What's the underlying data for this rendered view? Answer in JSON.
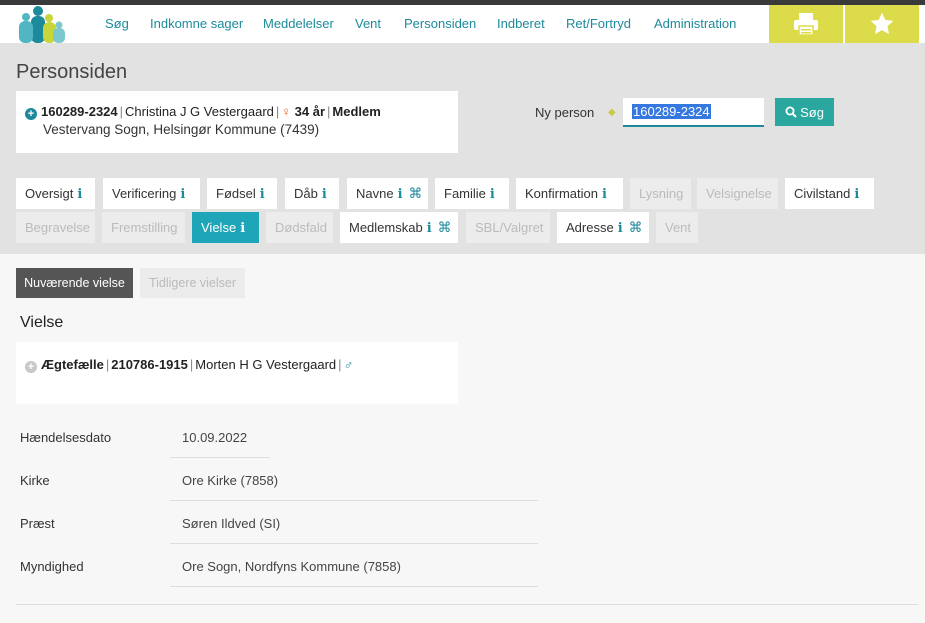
{
  "nav": {
    "items": [
      {
        "label": "Søg"
      },
      {
        "label": "Indkomne sager"
      },
      {
        "label": "Meddelelser"
      },
      {
        "label": "Vent"
      },
      {
        "label": "Personsiden"
      },
      {
        "label": "Indberet"
      },
      {
        "label": "Ret/Fortryd"
      },
      {
        "label": "Administration"
      }
    ],
    "print_icon": "printer-icon",
    "star_icon": "star-icon"
  },
  "page_title": "Personsiden",
  "person": {
    "cpr": "160289-2324",
    "name": "Christina J G Vestergaard",
    "age": "34 år",
    "status": "Medlem",
    "address": "Vestervang Sogn, Helsingør Kommune (7439)"
  },
  "new_person": {
    "label": "Ny person",
    "value": "160289-2324",
    "search_label": "Søg"
  },
  "tabs": {
    "row1": [
      {
        "label": "Oversigt",
        "info": "i"
      },
      {
        "label": "Verificering",
        "info": "i"
      },
      {
        "label": "Fødsel",
        "info": "i"
      },
      {
        "label": "Dåb",
        "info": "i"
      },
      {
        "label": "Navne",
        "info": "i",
        "cmd": "⌘"
      },
      {
        "label": "Familie",
        "info": "i"
      },
      {
        "label": "Konfirmation",
        "info": "i"
      },
      {
        "label": "Lysning"
      },
      {
        "label": "Velsignelse"
      },
      {
        "label": "Civilstand",
        "info": "i"
      }
    ],
    "row2": [
      {
        "label": "Begravelse"
      },
      {
        "label": "Fremstilling"
      },
      {
        "label": "Vielse",
        "info": "i"
      },
      {
        "label": "Dødsfald"
      },
      {
        "label": "Medlemskab",
        "info": "i",
        "cmd": "⌘"
      },
      {
        "label": "SBL/Valgret"
      },
      {
        "label": "Adresse",
        "info": "i",
        "cmd": "⌘"
      },
      {
        "label": "Vent"
      }
    ]
  },
  "sub_tabs": {
    "current": "Nuværende vielse",
    "previous": "Tidligere vielser"
  },
  "section_title": "Vielse",
  "spouse": {
    "role": "Ægtefælle",
    "cpr": "210786-1915",
    "name": "Morten H G Vestergaard"
  },
  "fields": [
    {
      "label": "Hændelsesdato",
      "value": "10.09.2022"
    },
    {
      "label": "Kirke",
      "value": "Ore Kirke (7858)"
    },
    {
      "label": "Præst",
      "value": "Søren Ildved (SI)"
    },
    {
      "label": "Myndighed",
      "value": "Ore Sogn, Nordfyns Kommune (7858)"
    }
  ]
}
